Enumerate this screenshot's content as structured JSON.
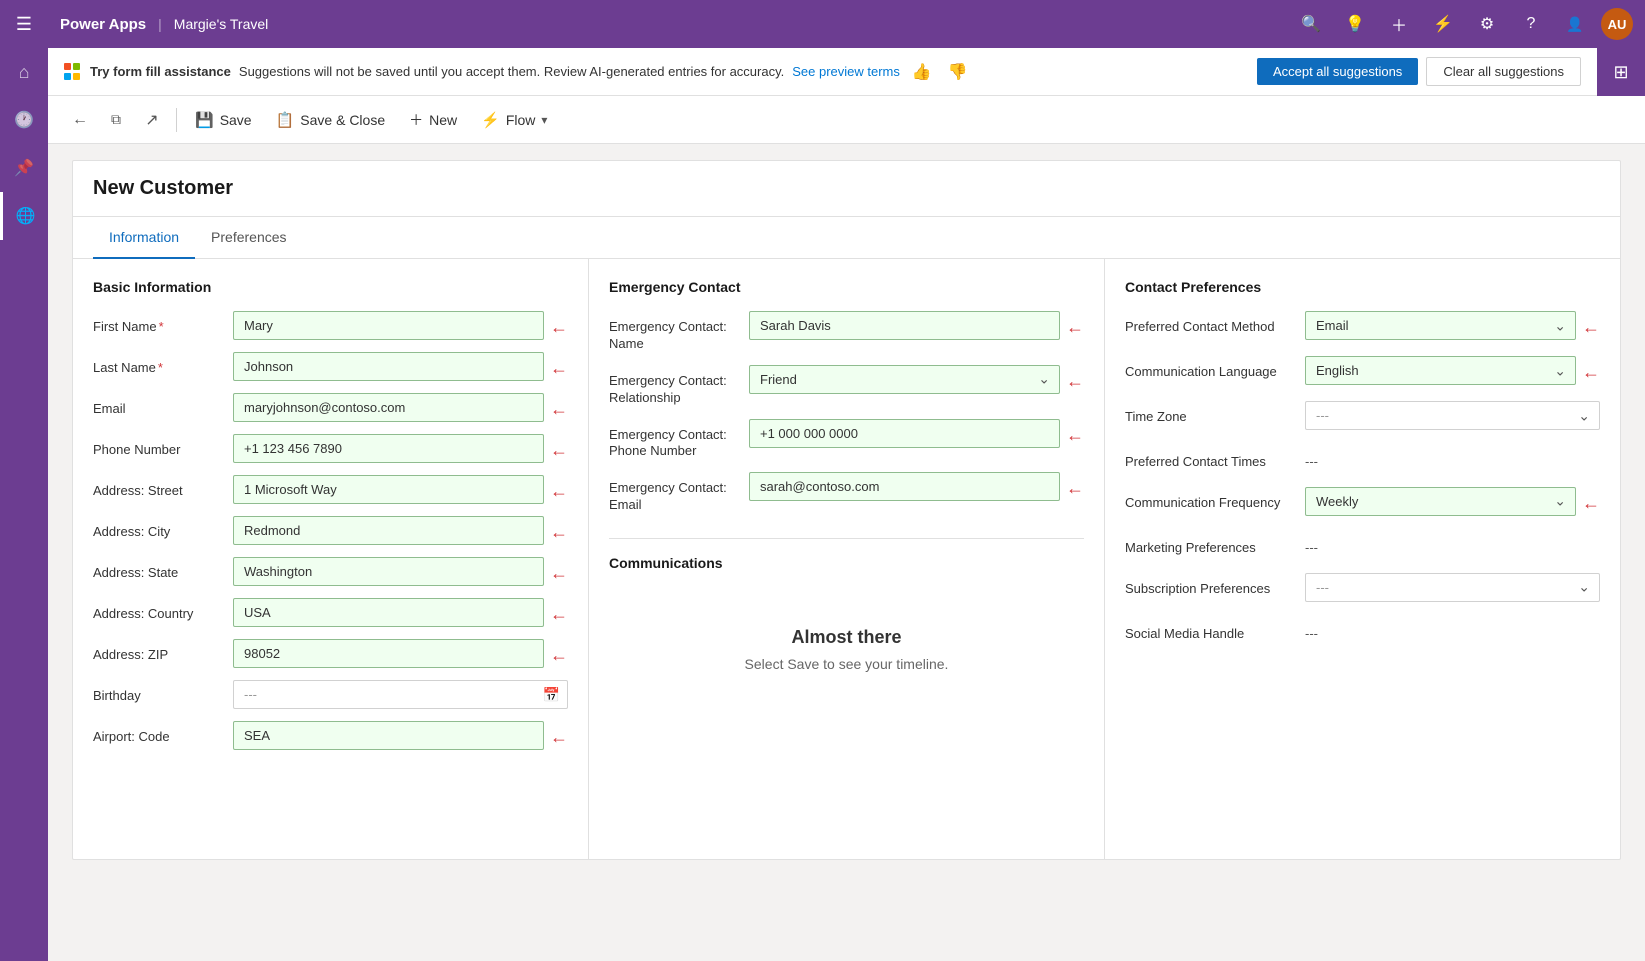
{
  "app": {
    "name": "Power Apps",
    "divider": "|",
    "sub_name": "Margie's Travel",
    "avatar_initials": "AU"
  },
  "suggestion_bar": {
    "bold_text": "Try form fill assistance",
    "text": " Suggestions will not be saved until you accept them. Review AI-generated entries for accuracy.",
    "link_text": "See preview terms",
    "accept_label": "Accept all suggestions",
    "clear_label": "Clear all suggestions"
  },
  "toolbar": {
    "back_label": "",
    "save_label": "Save",
    "save_close_label": "Save & Close",
    "new_label": "New",
    "flow_label": "Flow"
  },
  "page": {
    "title": "New Customer"
  },
  "tabs": [
    {
      "label": "Information",
      "active": true
    },
    {
      "label": "Preferences",
      "active": false
    }
  ],
  "basic_info": {
    "section_title": "Basic Information",
    "fields": [
      {
        "label": "First Name",
        "value": "Mary",
        "required": true,
        "highlighted": true
      },
      {
        "label": "Last Name",
        "value": "Johnson",
        "required": true,
        "highlighted": true
      },
      {
        "label": "Email",
        "value": "maryjohnson@contoso.com",
        "highlighted": true
      },
      {
        "label": "Phone Number",
        "value": "+1 123 456 7890",
        "highlighted": true
      },
      {
        "label": "Address: Street",
        "value": "1 Microsoft Way",
        "highlighted": true
      },
      {
        "label": "Address: City",
        "value": "Redmond",
        "highlighted": true
      },
      {
        "label": "Address: State",
        "value": "Washington",
        "highlighted": true
      },
      {
        "label": "Address: Country",
        "value": "USA",
        "highlighted": true
      },
      {
        "label": "Address: ZIP",
        "value": "98052",
        "highlighted": true
      },
      {
        "label": "Birthday",
        "value": "---",
        "empty": true,
        "date": true
      },
      {
        "label": "Airport: Code",
        "value": "SEA",
        "highlighted": true
      }
    ]
  },
  "emergency_contact": {
    "section_title": "Emergency Contact",
    "fields": [
      {
        "label": "Emergency Contact: Name",
        "value": "Sarah Davis",
        "highlighted": true
      },
      {
        "label": "Emergency Contact: Relationship",
        "value": "Friend",
        "select": true,
        "highlighted": true
      },
      {
        "label": "Emergency Contact: Phone Number",
        "value": "+1 000 000 0000",
        "highlighted": true
      },
      {
        "label": "Emergency Contact: Email",
        "value": "sarah@contoso.com",
        "highlighted": true
      }
    ],
    "communications_title": "Communications",
    "almost_there_title": "Almost there",
    "almost_there_text": "Select Save to see your timeline."
  },
  "contact_preferences": {
    "section_title": "Contact Preferences",
    "fields": [
      {
        "label": "Preferred Contact Method",
        "value": "Email",
        "select": true,
        "highlighted": true
      },
      {
        "label": "Communication Language",
        "value": "English",
        "select": true,
        "highlighted": true
      },
      {
        "label": "Time Zone",
        "value": "---",
        "select": true,
        "empty": true
      },
      {
        "label": "Preferred Contact Times",
        "value": "---",
        "plain": true
      },
      {
        "label": "Communication Frequency",
        "value": "Weekly",
        "select": true,
        "highlighted": true
      },
      {
        "label": "Marketing Preferences",
        "value": "---",
        "plain": true
      },
      {
        "label": "Subscription Preferences",
        "value": "---",
        "select": true,
        "empty": true
      },
      {
        "label": "Social Media Handle",
        "value": "---",
        "plain": true
      }
    ]
  }
}
